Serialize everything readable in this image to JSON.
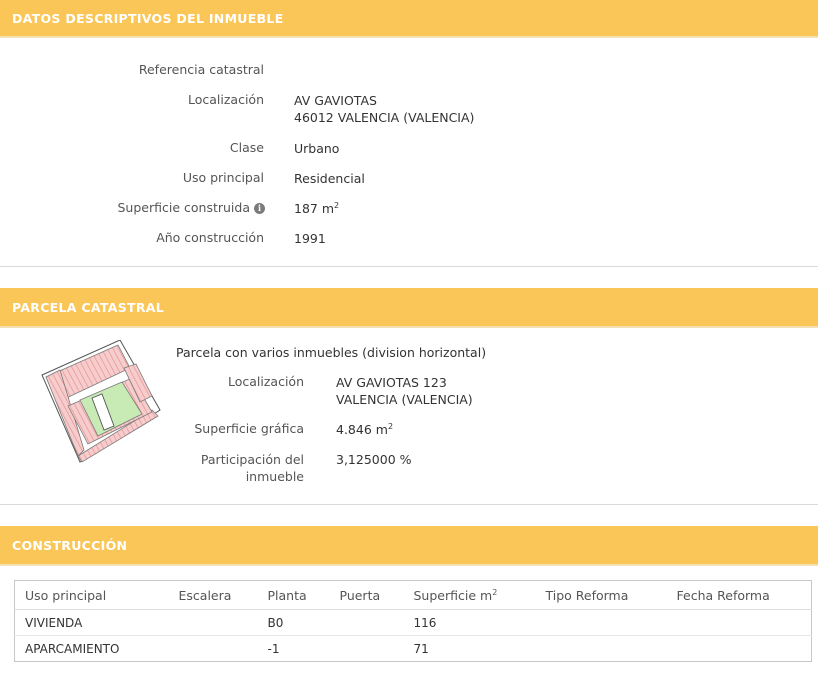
{
  "sections": {
    "datos": {
      "title": "DATOS DESCRIPTIVOS DEL INMUEBLE"
    },
    "parcela": {
      "title": "PARCELA CATASTRAL"
    },
    "construccion": {
      "title": "CONSTRUCCIÓN"
    }
  },
  "inmueble": {
    "referencia_label": "Referencia catastral",
    "referencia_value": "",
    "localizacion_label": "Localización",
    "localizacion_line1": "AV GAVIOTAS",
    "localizacion_line2": "46012 VALENCIA (VALENCIA)",
    "clase_label": "Clase",
    "clase_value": "Urbano",
    "uso_label": "Uso principal",
    "uso_value": "Residencial",
    "superficie_label": "Superficie construida",
    "superficie_value": "187 m",
    "superficie_unit_sup": "2",
    "anio_label": "Año construcción",
    "anio_value": "1991",
    "info_icon": "info-icon"
  },
  "parcela": {
    "heading": "Parcela con varios inmuebles (division horizontal)",
    "localizacion_label": "Localización",
    "localizacion_line1": "AV GAVIOTAS 123",
    "localizacion_line2": "VALENCIA (VALENCIA)",
    "superficie_label": "Superficie gráfica",
    "superficie_value": "4.846 m",
    "superficie_unit_sup": "2",
    "participacion_label_1": "Participación del",
    "participacion_label_2": "inmueble",
    "participacion_value": "3,125000 %",
    "map_icon": "parcel-plan-image"
  },
  "construccion": {
    "headers": [
      "Uso principal",
      "Escalera",
      "Planta",
      "Puerta",
      "Superficie m",
      "Tipo Reforma",
      "Fecha Reforma"
    ],
    "superficie_header_sup": "2",
    "rows": [
      [
        "VIVIENDA",
        "",
        "B0",
        "",
        "116",
        "",
        ""
      ],
      [
        "APARCAMIENTO",
        "",
        "-1",
        "",
        "71",
        "",
        ""
      ]
    ]
  },
  "colors": {
    "header_bg": "#fbc658",
    "header_text": "#ffffff",
    "parcel_pink": "#f4c6c6",
    "parcel_green": "#c8eab4"
  }
}
